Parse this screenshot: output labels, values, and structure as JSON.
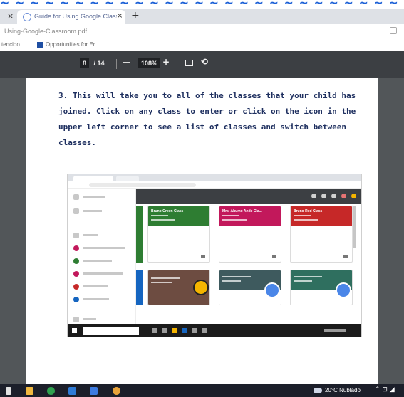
{
  "browser": {
    "tab_title": "Guide for Using Google Classro",
    "tab_close": "×",
    "new_tab": "+",
    "tab_left_close": "×",
    "url": "Using-Google-Classroom.pdf",
    "bookmarks": [
      "tencido...",
      "Opportunities for Er..."
    ]
  },
  "pdf": {
    "page_current": "8",
    "page_total": "/ 14",
    "zoom": "108%",
    "zoom_out": "—",
    "zoom_in": "+",
    "rotate": "⟲"
  },
  "page": {
    "instruction": "3. This will take you to all of the classes that your child has joined. Click on any class to enter or click on the icon in the upper left corner to see a list of classes and switch between classes."
  },
  "classroom_shot": {
    "cards": [
      {
        "title": "Bruno Green Class",
        "color": "#2e7d32"
      },
      {
        "title": "Mrs. Ahumo Ande Cla...",
        "color": "#c2185b"
      },
      {
        "title": "Bruno Red Class",
        "color": "#c62828"
      },
      {
        "title": "",
        "color": "#6d4c41"
      },
      {
        "title": "",
        "color": "#3e5a5e"
      },
      {
        "title": "",
        "color": "#2f6f5f"
      }
    ]
  },
  "taskbar": {
    "temperature": "20°C",
    "weather": "Nublado",
    "tray": "^ ⊡ ◢"
  },
  "colors": {
    "accent": "#1a5fd6",
    "toolbar": "#3c3f43",
    "viewer_bg": "#525659",
    "instruction_text": "#1e2f5f"
  }
}
